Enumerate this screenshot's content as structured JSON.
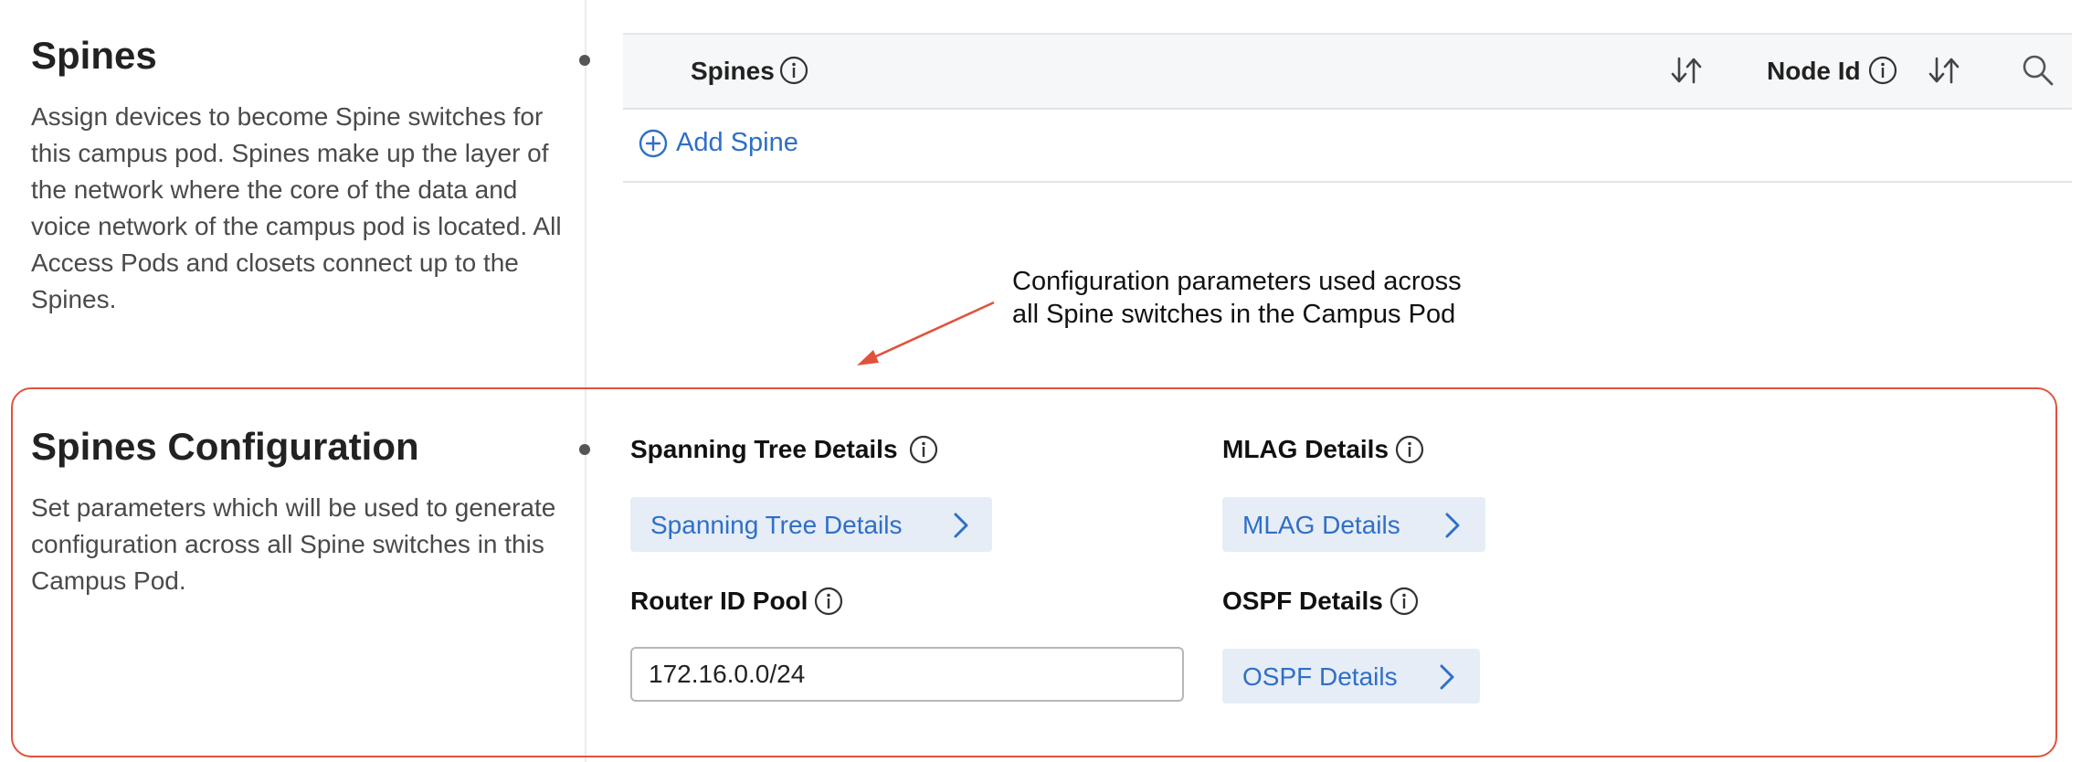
{
  "spines_section": {
    "title": "Spines",
    "description": "Assign devices to become Spine switches for this campus pod. Spines make up the layer of the network where the core of the data and voice network of the campus pod is located. All Access Pods and closets connect up to the Spines."
  },
  "table": {
    "columns": [
      "Spines",
      "Node Id"
    ],
    "add_label": "Add Spine",
    "icons": [
      "info-icon",
      "sort-icon",
      "search-icon",
      "plus-circle-icon"
    ]
  },
  "annotation": {
    "line1": "Configuration parameters used across",
    "line2": "all Spine switches in the Campus Pod",
    "color": "#e0533b"
  },
  "config_section": {
    "title": "Spines Configuration",
    "description": "Set parameters which will be used to generate configuration across all Spine switches in this Campus Pod.",
    "spanning_tree": {
      "label": "Spanning Tree Details",
      "button": "Spanning Tree Details"
    },
    "mlag": {
      "label": "MLAG Details",
      "button": "MLAG Details"
    },
    "router_id_pool": {
      "label": "Router ID Pool",
      "value": "172.16.0.0/24"
    },
    "ospf": {
      "label": "OSPF Details",
      "button": "OSPF Details"
    }
  },
  "colors": {
    "link": "#2f6fc6",
    "button_bg": "#e6edf7",
    "highlight_border": "#e0533b",
    "header_bg": "#f6f7f9"
  }
}
